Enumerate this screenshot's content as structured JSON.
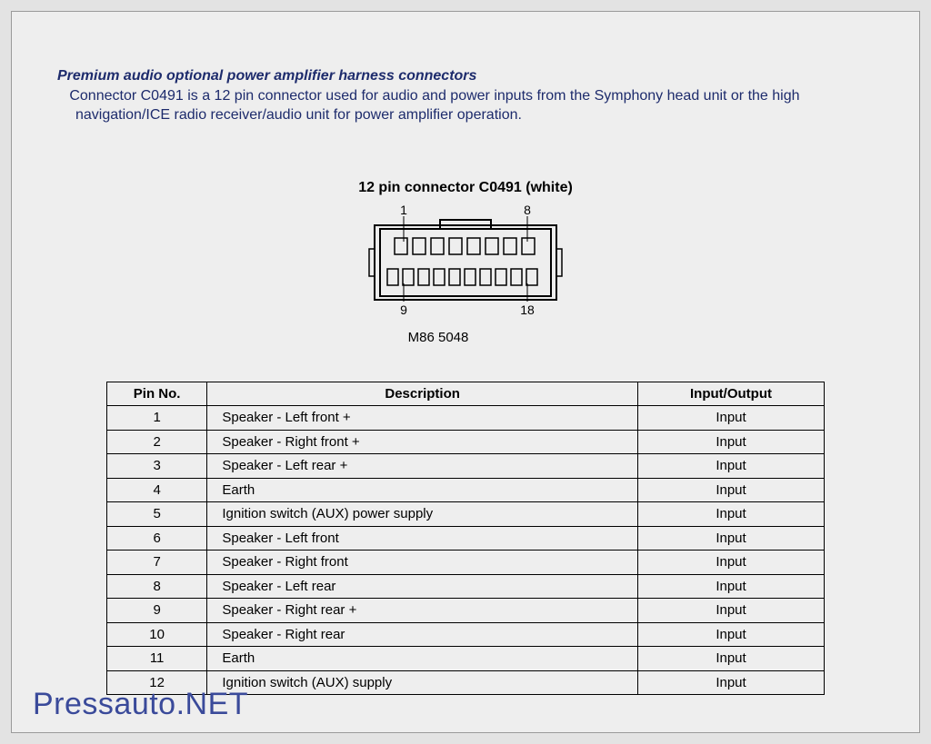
{
  "header": {
    "title": "Premium audio optional power amplifier harness connectors",
    "body": "Connector C0491 is a 12 pin connector used for audio and power inputs from the Symphony head unit or the high navigation/ICE radio receiver/audio unit for power amplifier operation."
  },
  "connector": {
    "title": "12 pin connector C0491 (white)",
    "pin_labels": {
      "tl": "1",
      "tr": "8",
      "bl": "9",
      "br": "18"
    },
    "part_no": "M86 5048"
  },
  "table": {
    "headers": {
      "pin": "Pin No.",
      "desc": "Description",
      "io": "Input/Output"
    },
    "rows": [
      {
        "pin": "1",
        "desc": "Speaker - Left front +",
        "io": "Input"
      },
      {
        "pin": "2",
        "desc": "Speaker - Right front +",
        "io": "Input"
      },
      {
        "pin": "3",
        "desc": "Speaker - Left rear +",
        "io": "Input"
      },
      {
        "pin": "4",
        "desc": "Earth",
        "io": "Input"
      },
      {
        "pin": "5",
        "desc": "Ignition switch (AUX) power supply",
        "io": "Input"
      },
      {
        "pin": "6",
        "desc": "Speaker - Left front",
        "io": "Input"
      },
      {
        "pin": "7",
        "desc": "Speaker - Right front",
        "io": "Input"
      },
      {
        "pin": "8",
        "desc": "Speaker - Left rear",
        "io": "Input"
      },
      {
        "pin": "9",
        "desc": "Speaker - Right rear +",
        "io": "Input"
      },
      {
        "pin": "10",
        "desc": "Speaker - Right rear",
        "io": "Input"
      },
      {
        "pin": "11",
        "desc": "Earth",
        "io": "Input"
      },
      {
        "pin": "12",
        "desc": "Ignition switch (AUX) supply",
        "io": "Input"
      }
    ]
  },
  "watermark": "Pressauto.NET"
}
